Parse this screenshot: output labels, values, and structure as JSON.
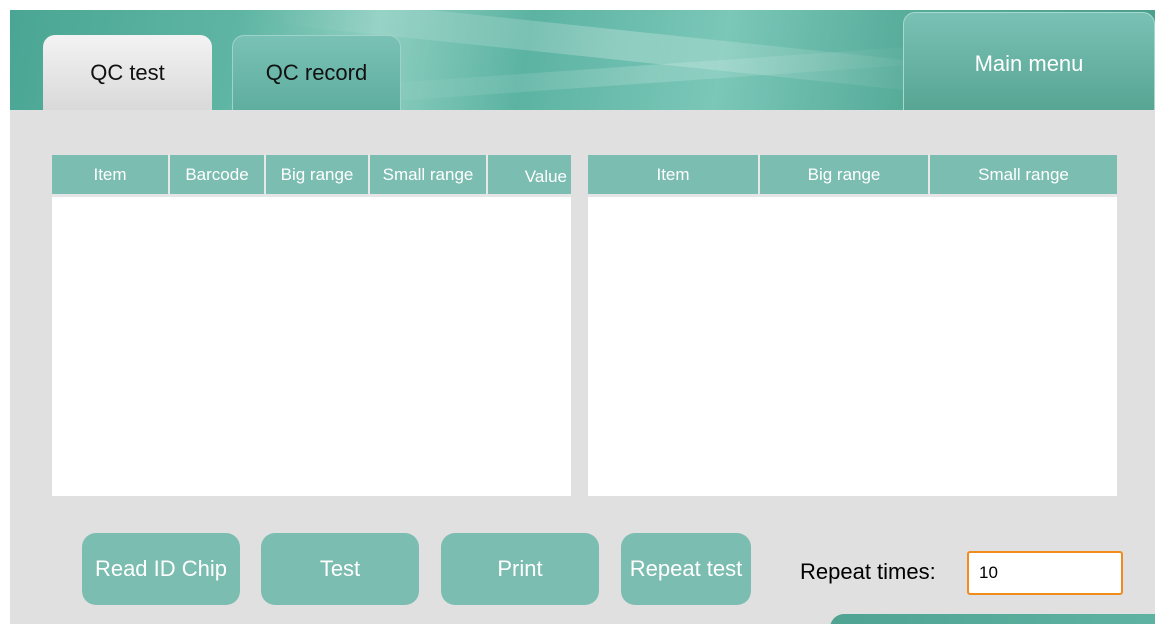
{
  "tabs": [
    {
      "label": "QC test",
      "active": true
    },
    {
      "label": "QC record",
      "active": false
    }
  ],
  "header": {
    "main_menu_label": "Main menu"
  },
  "left_table": {
    "columns": [
      "Item",
      "Barcode",
      "Big range",
      "Small range",
      "Value"
    ],
    "rows": []
  },
  "right_table": {
    "columns": [
      "Item",
      "Big range",
      "Small range"
    ],
    "rows": []
  },
  "actions": {
    "read_id_chip": "Read ID Chip",
    "test": "Test",
    "print": "Print",
    "repeat_test": "Repeat test"
  },
  "repeat": {
    "label": "Repeat times:",
    "value": "10"
  },
  "colors": {
    "accent": "#7bbdb1",
    "header": "#5cb3a2",
    "input_border": "#f08b1d",
    "background": "#e0e0e0"
  }
}
